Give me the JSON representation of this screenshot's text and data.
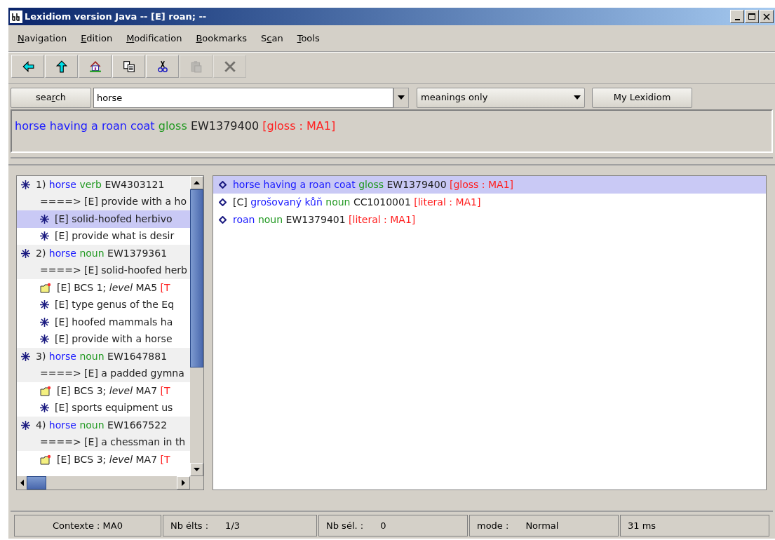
{
  "window": {
    "title": "Lexidiom version Java  -- [E] roan; --"
  },
  "menu": [
    {
      "key": "N",
      "after": "avigation"
    },
    {
      "key": "E",
      "after": "dition"
    },
    {
      "key": "M",
      "after": "odification"
    },
    {
      "key": "B",
      "after": "ookmarks"
    },
    {
      "before": "S",
      "key": "c",
      "after": "an"
    },
    {
      "key": "T",
      "after": "ools"
    }
  ],
  "toolbar": [
    {
      "kind": "back",
      "disabled": false
    },
    {
      "kind": "up",
      "disabled": false
    },
    {
      "kind": "home",
      "disabled": false
    },
    {
      "kind": "copy",
      "disabled": false
    },
    {
      "kind": "cut",
      "disabled": false
    },
    {
      "kind": "paste",
      "disabled": true
    },
    {
      "kind": "delete",
      "disabled": true
    }
  ],
  "search": {
    "button": {
      "before": "sea",
      "key": "r",
      "after": "ch"
    },
    "value": "horse",
    "filter": "meanings only",
    "my_button": "My Lexidiom"
  },
  "result": [
    {
      "kind": "head",
      "text": "horse having a roan coat"
    },
    {
      "kind": "pos",
      "text": "gloss"
    },
    {
      "kind": "code",
      "text": "EW1379400"
    },
    {
      "kind": "source",
      "text": "[gloss : MA1]"
    }
  ],
  "tree": [
    {
      "kind": "entry",
      "selected": false,
      "parts": [
        {
          "kind": "code",
          "text": "1)"
        },
        {
          "kind": "head",
          "text": "horse"
        },
        {
          "kind": "pos",
          "text": "verb"
        },
        {
          "kind": "code",
          "text": "EW4303121"
        }
      ]
    },
    {
      "kind": "definition",
      "selected": false,
      "parts": [
        {
          "kind": "code",
          "text": "====> [E] provide with a ho"
        }
      ]
    },
    {
      "kind": "sense",
      "selected": true,
      "parts": [
        {
          "kind": "code",
          "text": "[E] solid-hoofed herbivo"
        }
      ]
    },
    {
      "kind": "sense",
      "selected": false,
      "parts": [
        {
          "kind": "code",
          "text": "[E] provide what is desir"
        }
      ]
    },
    {
      "kind": "entry",
      "selected": false,
      "parts": [
        {
          "kind": "code",
          "text": "2)"
        },
        {
          "kind": "head",
          "text": "horse"
        },
        {
          "kind": "pos",
          "text": "noun"
        },
        {
          "kind": "code",
          "text": "EW1379361"
        }
      ]
    },
    {
      "kind": "definition",
      "selected": false,
      "parts": [
        {
          "kind": "code",
          "text": "====> [E] solid-hoofed herb"
        }
      ]
    },
    {
      "kind": "bcs",
      "selected": false,
      "parts": [
        {
          "kind": "code",
          "text": "[E] BCS 1; *level* MA5"
        },
        {
          "kind": "source",
          "text": "[T"
        }
      ]
    },
    {
      "kind": "sense",
      "selected": false,
      "parts": [
        {
          "kind": "code",
          "text": "[E] type genus of the Eq"
        }
      ]
    },
    {
      "kind": "sense",
      "selected": false,
      "parts": [
        {
          "kind": "code",
          "text": "[E] hoofed mammals ha"
        }
      ]
    },
    {
      "kind": "sense",
      "selected": false,
      "parts": [
        {
          "kind": "code",
          "text": "[E] provide with a horse"
        }
      ]
    },
    {
      "kind": "entry",
      "selected": false,
      "parts": [
        {
          "kind": "code",
          "text": "3)"
        },
        {
          "kind": "head",
          "text": "horse"
        },
        {
          "kind": "pos",
          "text": "noun"
        },
        {
          "kind": "code",
          "text": "EW1647881"
        }
      ]
    },
    {
      "kind": "definition",
      "selected": false,
      "parts": [
        {
          "kind": "code",
          "text": "====> [E] a padded gymna"
        }
      ]
    },
    {
      "kind": "bcs",
      "selected": false,
      "parts": [
        {
          "kind": "code",
          "text": "[E] BCS 3; *level* MA7"
        },
        {
          "kind": "source",
          "text": "[T"
        }
      ]
    },
    {
      "kind": "sense",
      "selected": false,
      "parts": [
        {
          "kind": "code",
          "text": "[E] sports equipment us"
        }
      ]
    },
    {
      "kind": "entry",
      "selected": false,
      "parts": [
        {
          "kind": "code",
          "text": "4)"
        },
        {
          "kind": "head",
          "text": "horse"
        },
        {
          "kind": "pos",
          "text": "noun"
        },
        {
          "kind": "code",
          "text": "EW1667522"
        }
      ]
    },
    {
      "kind": "definition",
      "selected": false,
      "parts": [
        {
          "kind": "code",
          "text": "====> [E] a chessman in th"
        }
      ]
    },
    {
      "kind": "bcs",
      "selected": false,
      "parts": [
        {
          "kind": "code",
          "text": "[E] BCS 3; *level* MA7"
        },
        {
          "kind": "source",
          "text": "[T"
        }
      ]
    }
  ],
  "details": [
    {
      "selected": true,
      "parts": [
        {
          "kind": "head",
          "text": "horse having a roan coat"
        },
        {
          "kind": "pos",
          "text": "gloss"
        },
        {
          "kind": "code",
          "text": "EW1379400"
        },
        {
          "kind": "source",
          "text": "[gloss : MA1]"
        }
      ]
    },
    {
      "selected": false,
      "parts": [
        {
          "kind": "code",
          "text": "[C]"
        },
        {
          "kind": "head",
          "text": "grošovaný kůň"
        },
        {
          "kind": "pos",
          "text": "noun"
        },
        {
          "kind": "code",
          "text": "CC1010001"
        },
        {
          "kind": "source",
          "text": "[literal : MA1]"
        }
      ]
    },
    {
      "selected": false,
      "parts": [
        {
          "kind": "head",
          "text": "roan"
        },
        {
          "kind": "pos",
          "text": "noun"
        },
        {
          "kind": "code",
          "text": "EW1379401"
        },
        {
          "kind": "source",
          "text": "[literal : MA1]"
        }
      ]
    }
  ],
  "status_bar": [
    {
      "label": "Contexte : MA0"
    },
    {
      "label": "Nb élts :",
      "value": "1/3"
    },
    {
      "label": "Nb sél. :",
      "value": "0"
    },
    {
      "label": "mode :",
      "value": "Normal"
    },
    {
      "label": "31 ms"
    }
  ]
}
